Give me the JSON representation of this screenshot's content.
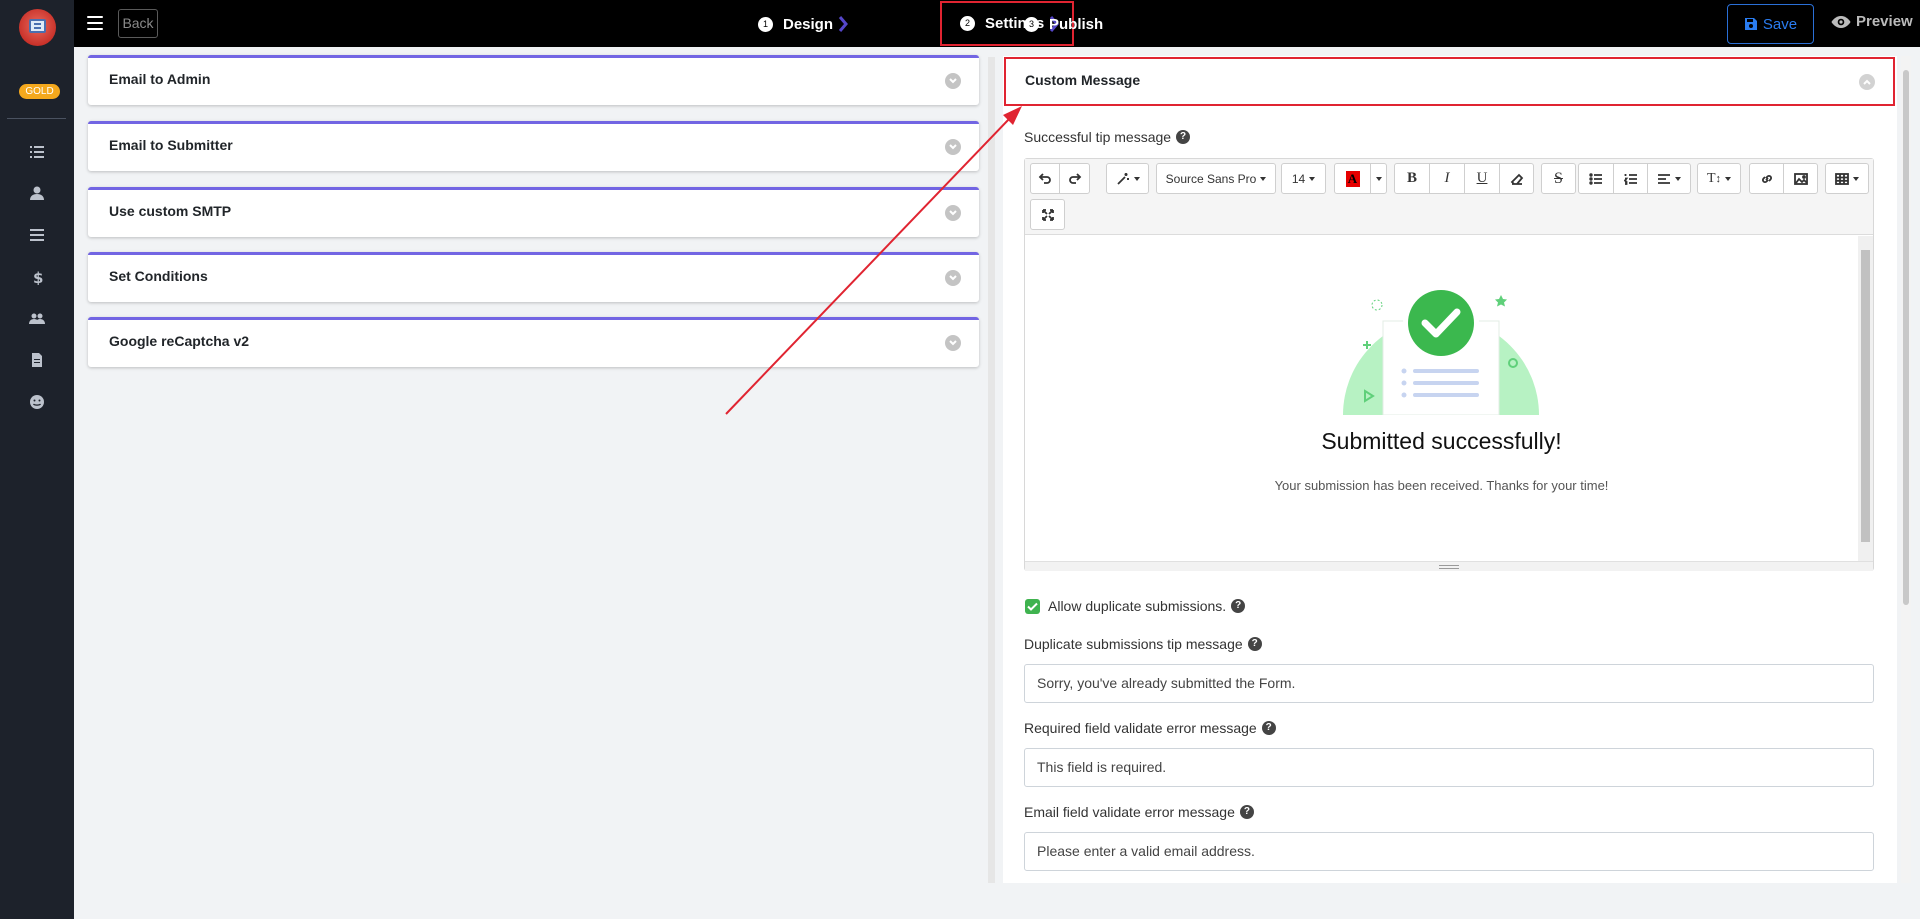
{
  "sidebar": {
    "badge": "GOLD",
    "icons": [
      "list-icon",
      "user-icon",
      "menu-lines-icon",
      "dollar-icon",
      "users-icon",
      "document-icon",
      "smile-icon"
    ]
  },
  "topbar": {
    "back_label": "Back",
    "steps": [
      {
        "num": "1",
        "label": "Design"
      },
      {
        "num": "2",
        "label": "Settings"
      },
      {
        "num": "3",
        "label": "Publish"
      }
    ],
    "save_label": "Save",
    "preview_label": "Preview",
    "accent_color": "#2a7cf0",
    "highlight_color": "#e02431"
  },
  "left_sections": [
    {
      "title": "Email to Admin"
    },
    {
      "title": "Email to Submitter"
    },
    {
      "title": "Use custom SMTP"
    },
    {
      "title": "Set Conditions"
    },
    {
      "title": "Google reCaptcha v2"
    }
  ],
  "custom_message": {
    "title": "Custom Message",
    "tip_label": "Successful tip message",
    "toolbar": {
      "font_family": "Source Sans Pro",
      "font_size": "14"
    },
    "preview": {
      "title": "Submitted successfully!",
      "subtitle": "Your submission has been received. Thanks for your time!"
    },
    "allow_duplicate_label": "Allow duplicate submissions.",
    "allow_duplicate_checked": true,
    "duplicate_label": "Duplicate submissions tip message",
    "duplicate_value": "Sorry, you've already submitted the Form.",
    "required_label": "Required field validate error message",
    "required_value": "This field is required.",
    "email_label": "Email field validate error message",
    "email_value": "Please enter a valid email address."
  }
}
